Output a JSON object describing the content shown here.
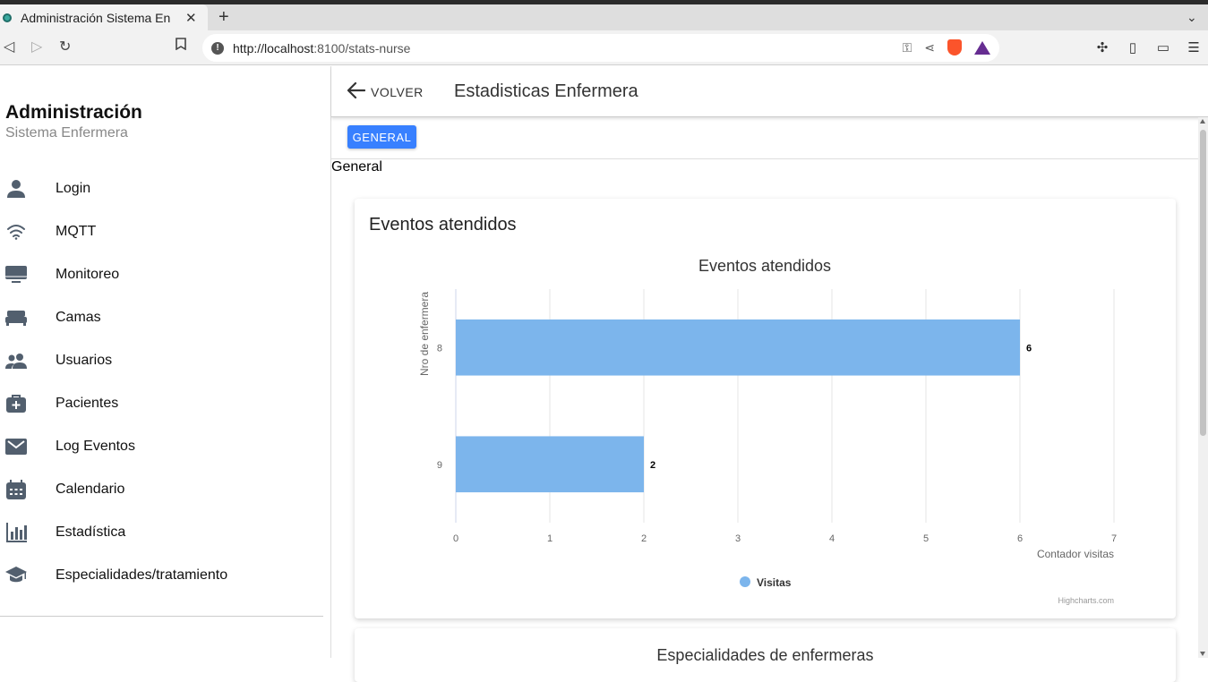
{
  "browser": {
    "tab_title": "Administración Sistema En",
    "tab_close": "✕",
    "new_tab": "+",
    "url_host": "http://localhost",
    "url_rest": ":8100/stats-nurse"
  },
  "sidebar": {
    "title": "Administración",
    "subtitle": "Sistema Enfermera",
    "items": [
      {
        "label": "Login",
        "icon": "person-icon"
      },
      {
        "label": "MQTT",
        "icon": "wifi-icon"
      },
      {
        "label": "Monitoreo",
        "icon": "desktop-icon"
      },
      {
        "label": "Camas",
        "icon": "bed-icon"
      },
      {
        "label": "Usuarios",
        "icon": "people-icon"
      },
      {
        "label": "Pacientes",
        "icon": "medkit-icon"
      },
      {
        "label": "Log Eventos",
        "icon": "mail-icon"
      },
      {
        "label": "Calendario",
        "icon": "calendar-icon"
      },
      {
        "label": "Estadística",
        "icon": "stats-chart-icon"
      },
      {
        "label": "Especialidades/tratamiento",
        "icon": "school-icon"
      }
    ]
  },
  "header": {
    "back_label": "VOLVER",
    "title": "Estadisticas Enfermera"
  },
  "segment": {
    "button_label": "GENERAL",
    "section_label": "General"
  },
  "card": {
    "title": "Eventos atendidos"
  },
  "card2": {
    "title": "Especialidades de enfermeras"
  },
  "colors": {
    "accent": "#3880ff",
    "bar": "#7cb5ec",
    "icon": "#525f6e"
  },
  "chart_data": {
    "type": "bar",
    "orientation": "horizontal",
    "title": "Eventos atendidos",
    "categories": [
      "8",
      "9"
    ],
    "series": [
      {
        "name": "Visitas",
        "values": [
          6,
          2
        ]
      }
    ],
    "xlabel": "Contador visitas",
    "ylabel": "Nro de enfermera",
    "xlim": [
      0,
      7
    ],
    "xticks": [
      "0",
      "1",
      "2",
      "3",
      "4",
      "5",
      "6",
      "7"
    ],
    "data_labels": [
      "6",
      "2"
    ],
    "grid": true,
    "legend": "bottom-center",
    "credits": "Highcharts.com"
  }
}
